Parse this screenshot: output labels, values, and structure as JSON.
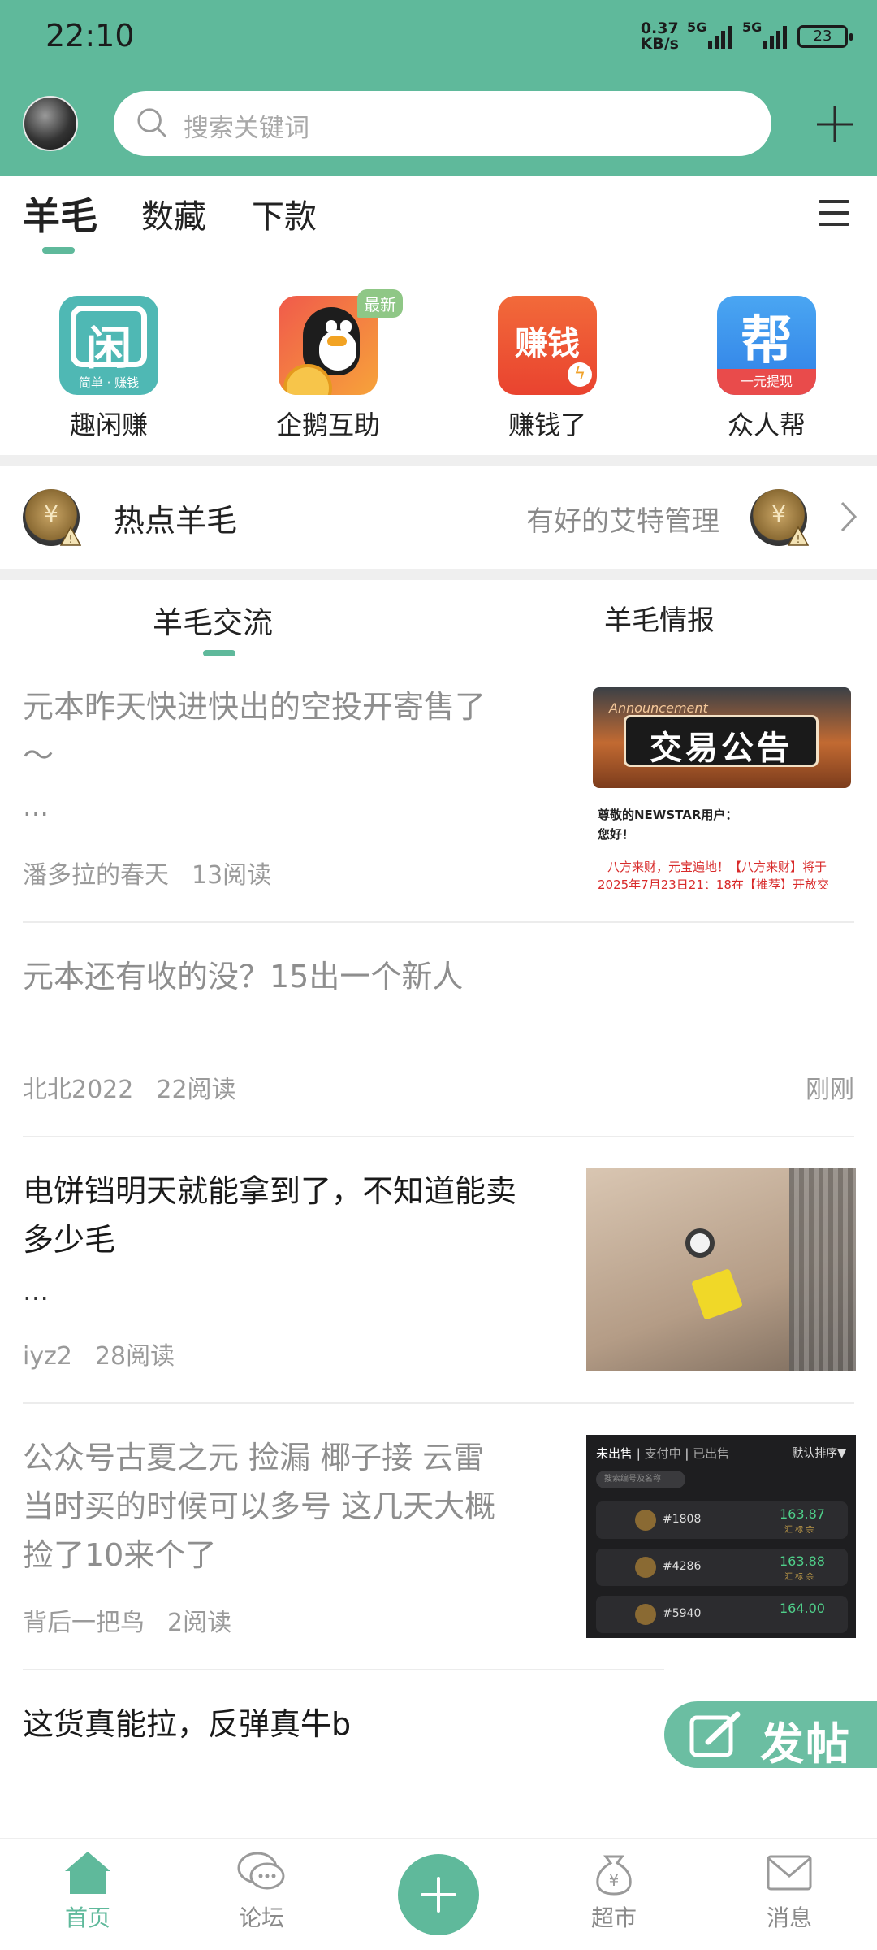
{
  "status_bar": {
    "time": "22:10",
    "net_speed_value": "0.37",
    "net_speed_unit": "KB/s",
    "sim1": "5G",
    "sim2": "5G",
    "battery": "23"
  },
  "header": {
    "search_placeholder": "搜索关键词",
    "accent_color": "#5fb99b"
  },
  "category_tabs": [
    {
      "label": "羊毛",
      "active": true
    },
    {
      "label": "数藏",
      "active": false
    },
    {
      "label": "下款",
      "active": false
    }
  ],
  "apps": [
    {
      "label": "趣闲赚",
      "icon": "qxz-app-icon",
      "sub": "简单 · 赚钱"
    },
    {
      "label": "企鹅互助",
      "icon": "penguin-app-icon",
      "badge": "最新"
    },
    {
      "label": "赚钱了",
      "icon": "zqle-app-icon",
      "glyph": "赚钱"
    },
    {
      "label": "众人帮",
      "icon": "zrb-app-icon",
      "glyph": "帮",
      "sub": "一元提现"
    }
  ],
  "hot": {
    "title": "热点羊毛",
    "subtitle": "有好的艾特管理"
  },
  "sub_tabs": [
    {
      "label": "羊毛交流",
      "active": true
    },
    {
      "label": "羊毛情报",
      "active": false
    }
  ],
  "posts": [
    {
      "title_line1": "元本昨天快进快出的空投开寄售了",
      "title_line2": "～",
      "ellipsis": "…",
      "author": "潘多拉的春天",
      "reads": "13阅读",
      "thumb": {
        "banner": "交易公告",
        "banner_en": "Announcement",
        "greeting": "尊敬的NEWSTAR用户：",
        "hello": "您好！",
        "notice_line1": "八方来财，元宝遍地！【八方来财】将于",
        "notice_line2": "2025年7月23日21：18在【推荐】开放交"
      }
    },
    {
      "title_line1": "元本还有收的没？15出一个新人",
      "author": "北北2022",
      "reads": "22阅读",
      "time": "刚刚"
    },
    {
      "title_line1": "电饼铛明天就能拿到了，不知道能卖",
      "title_line2": "多少毛",
      "ellipsis": "…",
      "author": "iyz2",
      "reads": "28阅读"
    },
    {
      "title_line1": "公众号古夏之元 捡漏 椰子接 云雷",
      "title_line2": "当时买的时候可以多号 这几天大概",
      "title_line3": "捡了10来个了",
      "author": "背后一把鸟",
      "reads": "2阅读",
      "thumb": {
        "tab_unsold": "未出售",
        "tab_paying": "支付中",
        "tab_sold": "已出售",
        "sort": "默认排序▼",
        "search": "搜索编号及名称",
        "items": [
          {
            "id": "#1808",
            "price": "163.87",
            "tag": "汇 标 余"
          },
          {
            "id": "#4286",
            "price": "163.88",
            "tag": "汇 标 余"
          },
          {
            "id": "#5940",
            "price": "164.00",
            "tag": "汇 标 余"
          }
        ]
      }
    },
    {
      "title_line1": "这货真能拉，反弹真牛b"
    }
  ],
  "fab": {
    "label": "发帖"
  },
  "bottom_nav": [
    {
      "label": "首页",
      "icon": "home-icon",
      "active": true
    },
    {
      "label": "论坛",
      "icon": "forum-icon",
      "active": false
    },
    {
      "label": "超市",
      "icon": "market-icon",
      "active": false
    },
    {
      "label": "消息",
      "icon": "message-icon",
      "active": false
    }
  ]
}
